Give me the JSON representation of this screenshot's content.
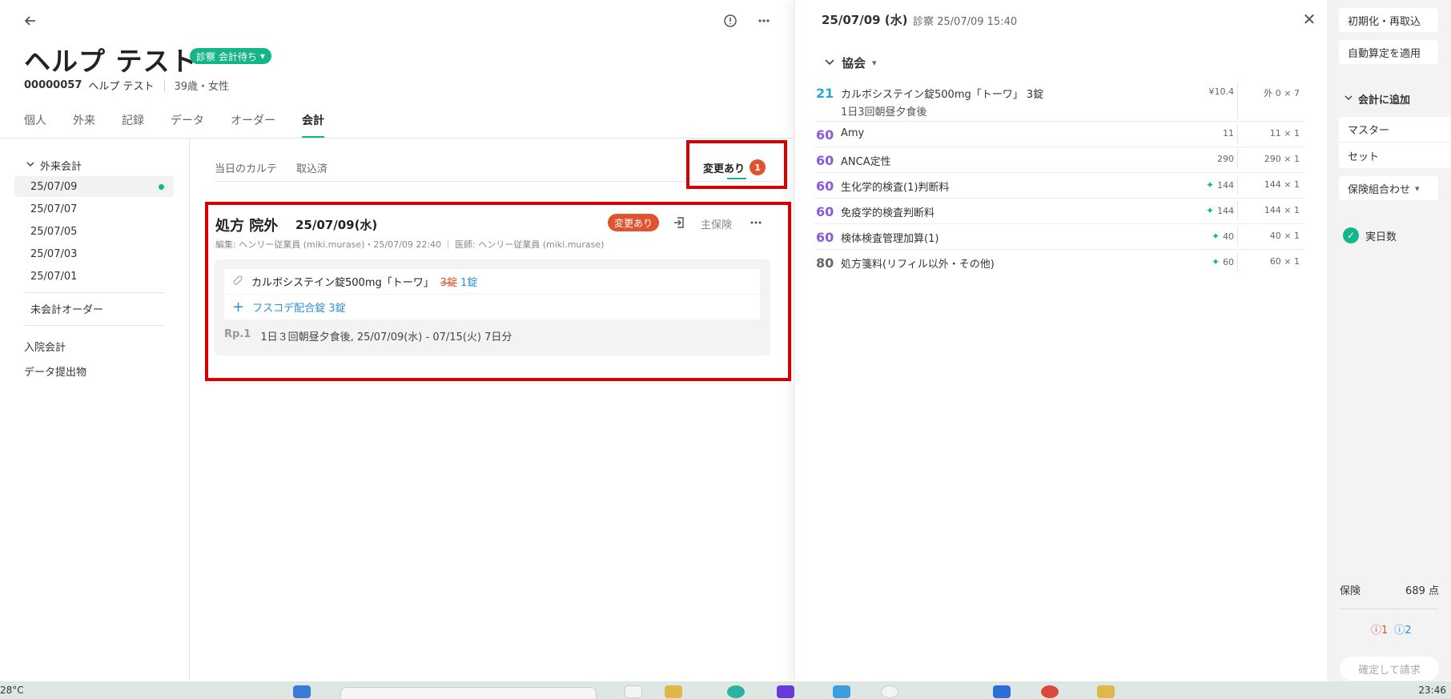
{
  "header": {
    "patient_name": "ヘルプ テスト",
    "status": "診察 会計待ち",
    "patient_id": "00000057",
    "patient_name_small": "ヘルプ テスト",
    "age_sex": "39歳・女性"
  },
  "main_tabs": [
    "個人",
    "外来",
    "記録",
    "データ",
    "オーダー",
    "会計"
  ],
  "sidebar": {
    "section": "外来会計",
    "dates": [
      "25/07/09",
      "25/07/07",
      "25/07/05",
      "25/07/03",
      "25/07/01"
    ],
    "unbilled": "未会計オーダー",
    "inpatient": "入院会計",
    "data_export": "データ提出物"
  },
  "sub_tabs": [
    "当日のカルテ",
    "取込済"
  ],
  "changed_tab": {
    "label": "変更あり",
    "count": "1"
  },
  "order": {
    "title": "処方 院外",
    "date": "25/07/09(水)",
    "edited": "編集: ヘンリー従業員 (miki.murase)・25/07/09 22:40",
    "doctor": "医師: ヘンリー従業員 (miki.murase)",
    "changed_label": "変更あり",
    "main_insurance": "主保険",
    "drug_name": "カルボシステイン錠500mg「トーワ」",
    "old_qty": "3錠",
    "new_qty": "1錠",
    "added_drug": "フスコデ配合錠 3錠",
    "rp": "Rp.1",
    "rp_detail": "1日３回朝昼夕食後, 25/07/09(水) - 07/15(火) 7日分"
  },
  "right_pane": {
    "date": "25/07/09 (水)",
    "visit": "診察 25/07/09 15:40",
    "group": "協会",
    "items": [
      {
        "code": "21",
        "name": "カルボシステイン錠500mg「トーワ」 3錠",
        "sub": "1日3回朝昼夕食後",
        "price": "¥10.4",
        "qty": "外 0 × 7",
        "spark": false
      },
      {
        "code": "60",
        "name": "Amy",
        "sub": "",
        "price": "11",
        "qty": "11 × 1",
        "spark": false
      },
      {
        "code": "60",
        "name": "ANCA定性",
        "sub": "",
        "price": "290",
        "qty": "290 × 1",
        "spark": false
      },
      {
        "code": "60",
        "name": "生化学的検査(1)判断料",
        "sub": "",
        "price": "144",
        "qty": "144 × 1",
        "spark": true
      },
      {
        "code": "60",
        "name": "免疫学的検査判断料",
        "sub": "",
        "price": "144",
        "qty": "144 × 1",
        "spark": true
      },
      {
        "code": "60",
        "name": "検体検査管理加算(1)",
        "sub": "",
        "price": "40",
        "qty": "40 × 1",
        "spark": true
      },
      {
        "code": "80",
        "name": "処方箋料(リフィル以外・その他)",
        "sub": "",
        "price": "60",
        "qty": "60 × 1",
        "spark": true
      }
    ]
  },
  "side": {
    "reset_btn": "初期化・再取込",
    "auto_btn": "自動算定を適用",
    "add_head": "会計に追加",
    "master": "マスター",
    "set": "セット",
    "combo": "保険組合わせ",
    "days": "実日数",
    "insurance_label": "保険",
    "insurance_points": "689 点",
    "alert_red": "1",
    "alert_blue": "2",
    "confirm": "確定して請求"
  },
  "taskbar": {
    "temp": "28°C",
    "clock": "23:46"
  },
  "colors": {
    "accent": "#14b58a",
    "alert": "#e0532f",
    "highlight_box": "#d90000",
    "code21": "#2aa6d6",
    "code60": "#8a5ad9"
  }
}
